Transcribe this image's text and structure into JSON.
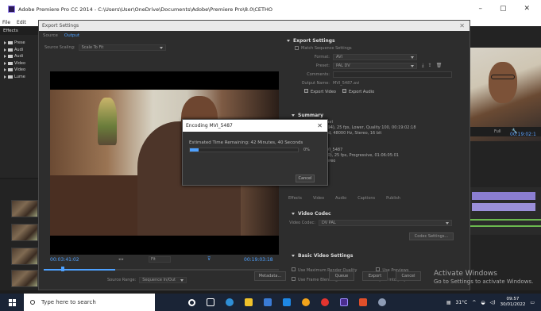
{
  "window": {
    "title": "Adobe Premiere Pro CC 2014 - C:\\Users\\User\\OneDrive\\Documents\\Adobe\\Premiere Pro\\8.0\\CETHO",
    "minimize": "–",
    "maximize": "▢",
    "close": "✕"
  },
  "menu": [
    "File",
    "Edit"
  ],
  "left_panel": {
    "title": "Effects",
    "items": [
      "Prese",
      "Audi",
      "Audi",
      "Video",
      "Video",
      "Lume"
    ]
  },
  "export_dialog": {
    "title": "Export Settings",
    "tabs": [
      "Source",
      "Output"
    ],
    "active_tab": "Output",
    "source_scaling_label": "Source Scaling:",
    "source_scaling_value": "Scale To Fit",
    "timecode_left": "00:03:41:02",
    "timecode_right": "00:19:03:18",
    "fit_value": "Fit",
    "source_range_label": "Source Range:",
    "source_range_value": "Sequence In/Out",
    "export_settings": {
      "header": "Export Settings",
      "match_sequence": "Match Sequence Settings",
      "format_label": "Format:",
      "format_value": "AVI",
      "preset_label": "Preset:",
      "preset_value": "PAL DV",
      "comments_label": "Comments:",
      "output_name_label": "Output Name:",
      "output_name_value": "MVI_5487.avi",
      "export_video": "Export Video",
      "export_audio": "Export Audio"
    },
    "summary": {
      "header": "Summary",
      "output_lines": [
        "...\\MVI_5487.avi",
        "720x576 (1,094), 25 fps, Lower, Quality 100, 00:19:02:18",
        "Uncompressed, 48000 Hz, Stereo, 16 bit"
      ],
      "source_lines": [
        "Sequence, MVI_5487",
        "1280x720 (1,0), 25 fps, Progressive, 01:06:05:01",
        "48000 Hz, Stereo"
      ]
    },
    "output_tabs": [
      "Effects",
      "Video",
      "Audio",
      "Captions",
      "Publish"
    ],
    "video_codec": {
      "header": "Video Codec",
      "codec_label": "Video Codec:",
      "codec_value": "DV PAL",
      "codec_settings_button": "Codec Settings..."
    },
    "basic_video": {
      "header": "Basic Video Settings"
    },
    "options": {
      "max_render": "Use Maximum Render Quality",
      "use_previews": "Use Previews",
      "frame_blending": "Use Frame Blending",
      "import_project": "Import into project"
    },
    "buttons": {
      "metadata": "Metadata...",
      "queue": "Queue",
      "export": "Export",
      "cancel": "Cancel"
    }
  },
  "encoding": {
    "title": "Encoding MVI_5487",
    "time_remaining": "Estimated Time Remaining: 42 Minutes, 40 Seconds",
    "percent": "0%",
    "progress": 0.08,
    "cancel": "Cancel"
  },
  "right_panel": {
    "timecode": "00:19:02:1",
    "fit": "Full"
  },
  "watermark": {
    "line1": "Activate Windows",
    "line2": "Go to Settings to activate Windows."
  },
  "taskbar": {
    "search_placeholder": "Type here to search",
    "temperature": "31°C",
    "time": "09:57",
    "date": "30/01/2022"
  },
  "colors": {
    "accent": "#4ea1ff",
    "taskbar": "#1a2436"
  }
}
